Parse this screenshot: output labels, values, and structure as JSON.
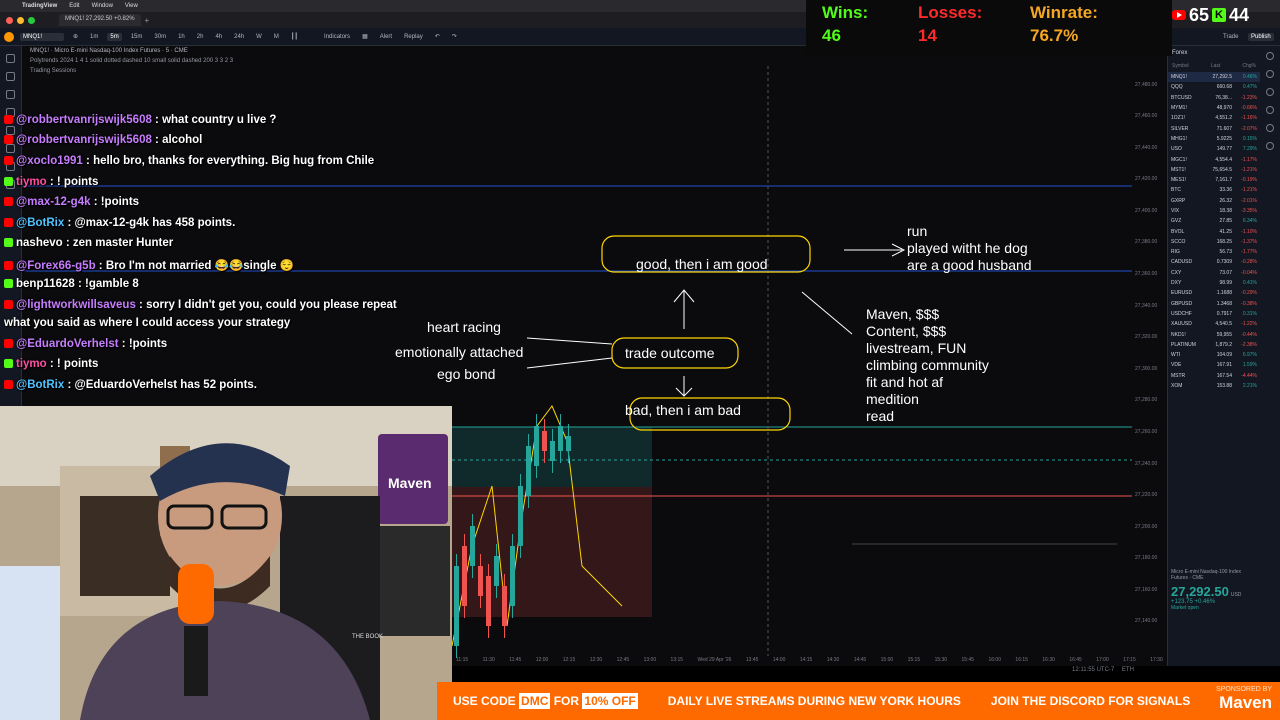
{
  "menubar": {
    "app": "TradingView",
    "items": [
      "Edit",
      "Window",
      "View"
    ]
  },
  "browser": {
    "tab_title": "MNQ1! 27,292.50 +0.82%"
  },
  "toolbar": {
    "symbol": "MNQ1!",
    "intervals": [
      "1m",
      "5m",
      "15m",
      "30m",
      "1h",
      "2h",
      "4h",
      "24h",
      "W",
      "M"
    ],
    "selected_interval": "5m",
    "indicators": "Indicators",
    "alert": "Alert",
    "replay": "Replay",
    "trade": "Trade",
    "publish": "Publish"
  },
  "chart": {
    "legend_title": "MNQ1! · Micro E-mini Nasdaq-100 Index Futures · 5 · CME",
    "legend_sub": "Polytrends 2024 1 4 1 solid dotted dashed 10 small solid dashed 200 3 3 2 3",
    "legend_sessions": "Trading Sessions",
    "price_ticks": [
      "27,500.00",
      "27,480.00",
      "27,460.00",
      "27,440.00",
      "27,420.00",
      "27,400.00",
      "27,380.00",
      "27,360.00",
      "27,340.00",
      "27,320.00",
      "27,300.00",
      "27,280.00",
      "27,260.00",
      "27,240.00",
      "27,220.00",
      "27,200.00",
      "27,180.00",
      "27,160.00",
      "27,140.00"
    ],
    "time_ticks": [
      "11:15",
      "11:30",
      "11:45",
      "12:00",
      "12:15",
      "12:30",
      "12:45",
      "13:00",
      "13:15",
      "Wed 29 Apr '26",
      "13:45",
      "14:00",
      "14:15",
      "14:30",
      "14:45",
      "15:00",
      "15:15",
      "15:30",
      "15:45",
      "16:00",
      "16:15",
      "16:30",
      "16:45",
      "17:00",
      "17:15",
      "17:30"
    ],
    "clock": "12:11:55 UTC-7",
    "session": "ETH"
  },
  "scoreboard": {
    "wins_label": "Wins:",
    "wins": "46",
    "losses_label": "Losses:",
    "losses": "14",
    "winrate_label": "Winrate:",
    "winrate": "76.7%",
    "colors": {
      "wins": "#53fc18",
      "losses": "#ff2a2a",
      "winrate": "#f5a623"
    }
  },
  "social": {
    "youtube_count": "65",
    "kick_count": "44"
  },
  "watchlist": {
    "title": "Forex",
    "headers": [
      "Symbol",
      "Last",
      "Chg%"
    ],
    "rows": [
      {
        "sym": "MNQ1!",
        "last": "27,292.5",
        "chg": "0.46%",
        "dir": "up"
      },
      {
        "sym": "QQQ",
        "last": "660.68",
        "chg": "0.47%",
        "dir": "up"
      },
      {
        "sym": "BTCUSD",
        "last": "76,38...",
        "chg": "-1.23%",
        "dir": "down"
      },
      {
        "sym": "MYM1!",
        "last": "48,970",
        "chg": "-0.66%",
        "dir": "down"
      },
      {
        "sym": "1OZ1!",
        "last": "4,551.2",
        "chg": "-1.16%",
        "dir": "down"
      },
      {
        "sym": "SILVER",
        "last": "71.607",
        "chg": "-2.07%",
        "dir": "down"
      },
      {
        "sym": "MHG1!",
        "last": "5.9225",
        "chg": "0.15%",
        "dir": "up"
      },
      {
        "sym": "USO",
        "last": "149.77",
        "chg": "7.29%",
        "dir": "up"
      },
      {
        "sym": "MGC1!",
        "last": "4,554.4",
        "chg": "-1.17%",
        "dir": "down"
      },
      {
        "sym": "MST1!",
        "last": "75,654.5",
        "chg": "-1.21%",
        "dir": "down"
      },
      {
        "sym": "MES1!",
        "last": "7,161.7",
        "chg": "-0.19%",
        "dir": "down"
      },
      {
        "sym": "BTC",
        "last": "33.36",
        "chg": "-1.21%",
        "dir": "down"
      },
      {
        "sym": "GXRP",
        "last": "26.32",
        "chg": "-2.01%",
        "dir": "down"
      },
      {
        "sym": "VIX",
        "last": "18.38",
        "chg": "-3.35%",
        "dir": "down"
      },
      {
        "sym": "GVZ",
        "last": "27.85",
        "chg": "6.34%",
        "dir": "up"
      },
      {
        "sym": "BVOL",
        "last": "41.25",
        "chg": "-1.10%",
        "dir": "down"
      },
      {
        "sym": "SCCO",
        "last": "168.25",
        "chg": "-1.37%",
        "dir": "down"
      },
      {
        "sym": "RIG",
        "last": "56.73",
        "chg": "-1.77%",
        "dir": "down"
      },
      {
        "sym": "CADUSD",
        "last": "0.7309",
        "chg": "-0.28%",
        "dir": "down"
      },
      {
        "sym": "CXY",
        "last": "73.07",
        "chg": "-0.04%",
        "dir": "down"
      },
      {
        "sym": "DXY",
        "last": "98.99",
        "chg": "0.41%",
        "dir": "up"
      },
      {
        "sym": "EURUSD",
        "last": "1.1688",
        "chg": "-0.29%",
        "dir": "down"
      },
      {
        "sym": "GBPUSD",
        "last": "1.3468",
        "chg": "-0.38%",
        "dir": "down"
      },
      {
        "sym": "USDCHF",
        "last": "0.7917",
        "chg": "0.31%",
        "dir": "up"
      },
      {
        "sym": "XAUUSD",
        "last": "4,540.5",
        "chg": "-1.22%",
        "dir": "down"
      },
      {
        "sym": "NKD1!",
        "last": "59,955",
        "chg": "-0.44%",
        "dir": "down"
      },
      {
        "sym": "PLATINUM",
        "last": "1,879.2",
        "chg": "-2.38%",
        "dir": "down"
      },
      {
        "sym": "WTI",
        "last": "104.09",
        "chg": "6.97%",
        "dir": "up"
      },
      {
        "sym": "VDE",
        "last": "167.91",
        "chg": "1.59%",
        "dir": "up"
      },
      {
        "sym": "MSTR",
        "last": "167.54",
        "chg": "-4.44%",
        "dir": "down"
      },
      {
        "sym": "XOM",
        "last": "153.88",
        "chg": "2.21%",
        "dir": "up"
      }
    ],
    "detail_title": "Micro E-mini Nasdaq-100 Index Futures · CME",
    "detail_price": "27,292.50",
    "detail_currency": "USD",
    "detail_change": "+123.75 +0.46%",
    "detail_status": "Market open"
  },
  "chat": {
    "messages": [
      {
        "badge": "yt",
        "user": "@robbertvanrijswijk5608",
        "user_color": "#c77dff",
        "text": " : what country u live ?"
      },
      {
        "badge": "yt",
        "user": "@robbertvanrijswijk5608",
        "user_color": "#c77dff",
        "text": " : alcohol"
      },
      {
        "badge": "yt",
        "user": "@xoclo1991",
        "user_color": "#c77dff",
        "text": " : hello bro, thanks for everything. Big hug from Chile"
      },
      {
        "badge": "kick",
        "user": "tiymo",
        "user_color": "#ff4fa3",
        "text": " : ! points"
      },
      {
        "badge": "yt",
        "user": "@max-12-g4k",
        "user_color": "#c77dff",
        "text": " : !points"
      },
      {
        "badge": "yt",
        "user": "@BotRix",
        "user_color": "#4fc3ff",
        "text": " : @max-12-g4k has 458 points."
      },
      {
        "badge": "kick",
        "user": "nashevo",
        "user_color": "#ffffff",
        "text": " : zen master Hunter"
      },
      {
        "badge": "yt",
        "user": "@Forex66-g5b",
        "user_color": "#c77dff",
        "text": " : Bro I'm not married 😂😂single 😌"
      },
      {
        "badge": "kick",
        "user": "benp11628",
        "user_color": "#ffffff",
        "text": " : !gamble 8"
      },
      {
        "badge": "yt",
        "user": "@lightworkwillsaveus",
        "user_color": "#c77dff",
        "text": " : sorry I didn't get you, could you please repeat"
      },
      {
        "badge": "none",
        "user": "",
        "user_color": "#ffffff",
        "text": "what you said as where I could access your strategy"
      },
      {
        "badge": "yt",
        "user": "@EduardoVerhelst",
        "user_color": "#c77dff",
        "text": " : !points"
      },
      {
        "badge": "kick",
        "user": "tiymo",
        "user_color": "#ff4fa3",
        "text": " : ! points"
      },
      {
        "badge": "yt",
        "user": "@BotRix",
        "user_color": "#4fc3ff",
        "text": " : @EduardoVerhelst has 52 points."
      }
    ]
  },
  "whiteboard": {
    "good": "good, then i am good",
    "run": "run",
    "played": "played witht he dog",
    "husband": "are a good husband",
    "heart": "heart racing",
    "emotion": "emotionally attached",
    "ego": "ego bond",
    "trade": "trade outcome",
    "bad": "bad, then i am bad",
    "maven_lines": [
      "Maven, $$$",
      "Content, $$$",
      "livestream, FUN",
      "climbing community",
      "fit and hot af",
      "medition",
      "read"
    ]
  },
  "webcam": {
    "poster_text": "Maven",
    "book_text": "THE BOOK"
  },
  "banner": {
    "code_prefix": "USE CODE",
    "code": "DMC",
    "code_suffix": "FOR",
    "discount": "10% OFF",
    "streams": "DAILY LIVE STREAMS DURING NEW YORK HOURS",
    "discord": "JOIN THE DISCORD FOR SIGNALS",
    "sponsor_label": "SPONSORED BY",
    "sponsor": "Maven"
  }
}
